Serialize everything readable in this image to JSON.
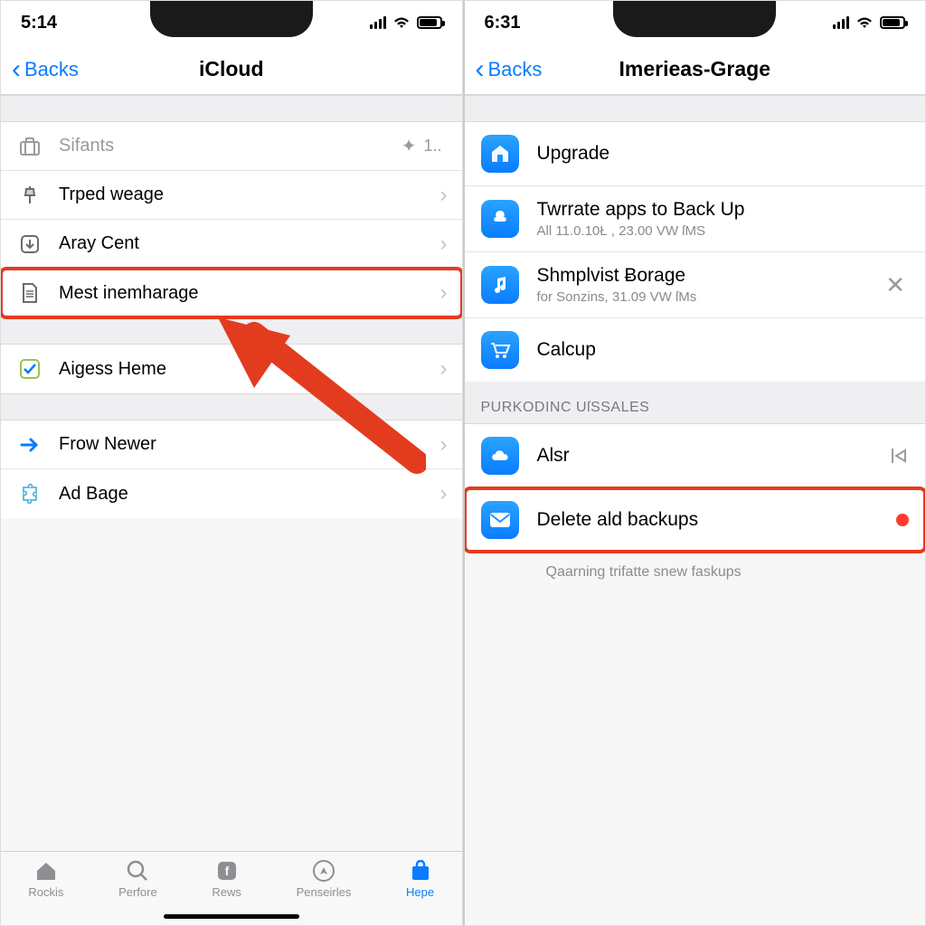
{
  "left": {
    "status_time": "5:14",
    "back_label": "Backs",
    "title": "iCloud",
    "row_sifants": {
      "label": "Sifants",
      "meta": "1.."
    },
    "rows1": [
      {
        "label": "Trped weage"
      },
      {
        "label": "Aray Cent"
      },
      {
        "label": "Mest inemharage"
      }
    ],
    "rows2": [
      {
        "label": "Aigess Heme"
      }
    ],
    "rows3": [
      {
        "label": "Frow Newer"
      },
      {
        "label": "Ad Bage"
      }
    ],
    "tabs": [
      {
        "label": "Rockis"
      },
      {
        "label": "Perfore"
      },
      {
        "label": "Rews"
      },
      {
        "label": "Penseirles"
      },
      {
        "label": "Hepe"
      }
    ]
  },
  "right": {
    "status_time": "6:31",
    "back_label": "Backs",
    "title": "Imerieas-Grage",
    "upgrade": "Upgrade",
    "apps": {
      "main": "Twrrate apps to Back Up",
      "sub": "All 11.0.10Ł , 23.00 VW ſMS"
    },
    "music": {
      "main": "Shmplvist Ƀorage",
      "sub": "for Sonzins, 31.09 VW ſMs"
    },
    "calcup": "Calcup",
    "section_header": "PURKODINC UſSSALES",
    "alsr": "Alsr",
    "delete": "Delete ald backups",
    "footnote": "Qaarning trifatte snew faskups"
  }
}
